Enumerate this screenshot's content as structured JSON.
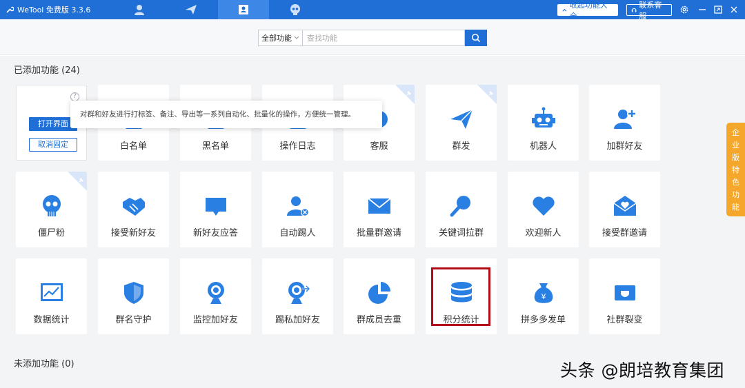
{
  "titlebar": {
    "app_name": "WeTool 免费版 3.3.6",
    "nav_icons": [
      "user-icon",
      "send-icon",
      "contact-card-icon",
      "skull-icon"
    ],
    "collapse_button": "收起功能大全",
    "support_button": "联系客服"
  },
  "search": {
    "scope_value": "全部功能",
    "placeholder": "查找功能"
  },
  "added_section": {
    "title": "已添加功能 (24)"
  },
  "not_added_section": {
    "title": "未添加功能 (0)"
  },
  "tooltip": "对群和好友进行打标签、备注、导出等一系列自动化、批量化的操作，方便统一管理。",
  "first_card": {
    "open_label": "打开界面",
    "unpin_label": "取消固定"
  },
  "cards": [
    {
      "label": "白名单",
      "icon": "whitelist-icon"
    },
    {
      "label": "黑名单",
      "icon": "blacklist-icon"
    },
    {
      "label": "操作日志",
      "icon": "log-icon"
    },
    {
      "label": "客服",
      "icon": "customer-service-icon"
    },
    {
      "label": "群发",
      "icon": "send-icon"
    },
    {
      "label": "机器人",
      "icon": "robot-icon"
    },
    {
      "label": "加群好友",
      "icon": "add-friend-icon"
    },
    {
      "label": "僵尸粉",
      "icon": "skull-icon"
    },
    {
      "label": "接受新好友",
      "icon": "handshake-icon"
    },
    {
      "label": "新好友应答",
      "icon": "chat-bubble-icon"
    },
    {
      "label": "自动踢人",
      "icon": "kick-user-icon"
    },
    {
      "label": "批量群邀请",
      "icon": "mail-icon"
    },
    {
      "label": "关键词拉群",
      "icon": "search-icon"
    },
    {
      "label": "欢迎新人",
      "icon": "heart-icon"
    },
    {
      "label": "接受群邀请",
      "icon": "mail-open-heart-icon"
    },
    {
      "label": "数据统计",
      "icon": "chart-icon"
    },
    {
      "label": "群名守护",
      "icon": "shield-icon"
    },
    {
      "label": "监控加好友",
      "icon": "webcam-icon"
    },
    {
      "label": "踢私加好友",
      "icon": "webcam-kick-icon"
    },
    {
      "label": "群成员去重",
      "icon": "pie-chart-icon"
    },
    {
      "label": "积分统计",
      "icon": "database-icon"
    },
    {
      "label": "拼多多发单",
      "icon": "money-bag-icon"
    },
    {
      "label": "社群裂变",
      "icon": "tag-icon"
    }
  ],
  "side_tab": [
    "企",
    "业",
    "版",
    "特",
    "色",
    "功",
    "能"
  ],
  "watermark": "头条 @朗培教育集团",
  "colors": {
    "brand_blue": "#1f6fd6",
    "icon_blue": "#2a7fe3",
    "highlight_red": "#b40c16",
    "side_tab_orange": "#f5a72b"
  }
}
